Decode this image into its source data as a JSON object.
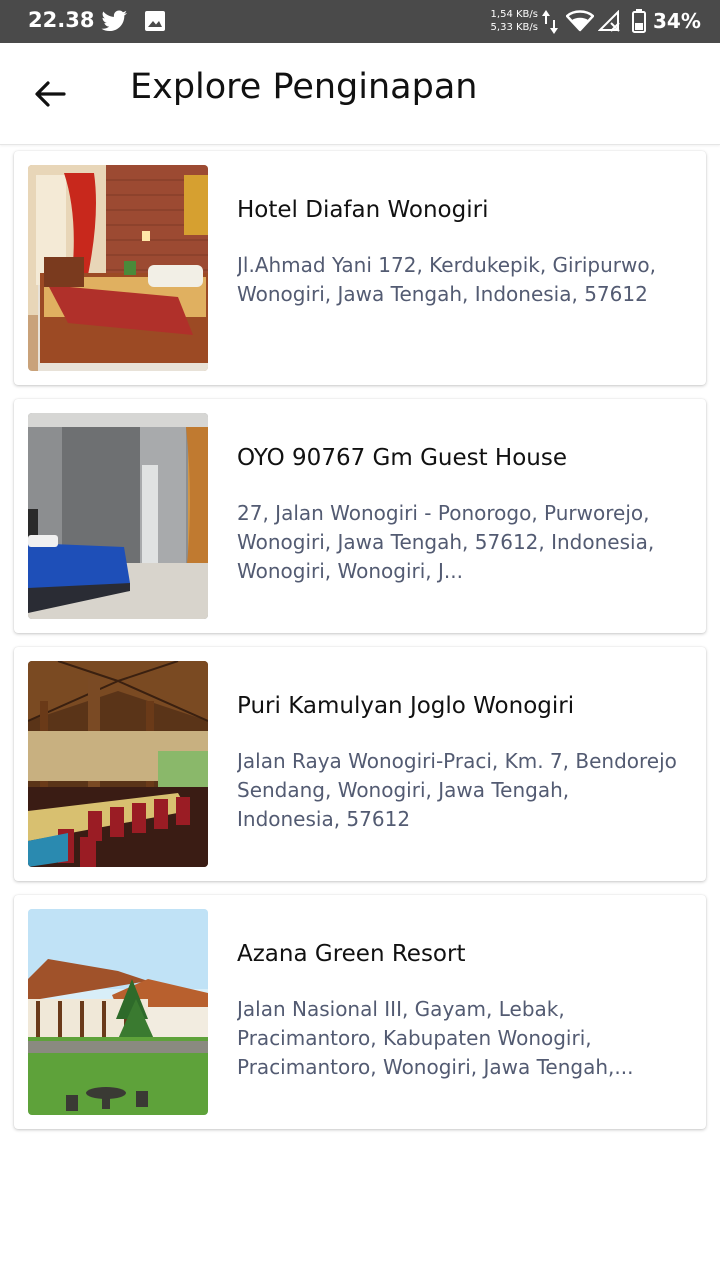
{
  "status_bar": {
    "time": "22.38",
    "speed_up": "1,54 KB/s",
    "speed_down": "5,33 KB/s",
    "battery": "34%",
    "icons": [
      "twitter-icon",
      "image-icon",
      "data-arrows-icon",
      "wifi-icon",
      "signal-icon",
      "battery-icon"
    ]
  },
  "app_bar": {
    "title": "Explore Penginapan",
    "back_icon": "arrow-left-icon"
  },
  "lodgings": [
    {
      "name": "Hotel Diafan Wonogiri",
      "address": "Jl.Ahmad Yani 172, Kerdukepik, Giripurwo, Wonogiri, Jawa Tengah, Indonesia, 57612"
    },
    {
      "name": "OYO 90767 Gm Guest House",
      "address": "27, Jalan Wonogiri - Ponorogo, Purworejo, Wonogiri, Jawa Tengah, 57612, Indonesia, Wonogiri, Wonogiri, J..."
    },
    {
      "name": "Puri Kamulyan Joglo Wonogiri",
      "address": "Jalan Raya Wonogiri-Praci, Km. 7, Bendorejo Sendang, Wonogiri, Jawa Tengah, Indonesia, 57612"
    },
    {
      "name": "Azana Green Resort",
      "address": "Jalan Nasional III, Gayam, Lebak, Pracimantoro, Kabupaten Wonogiri, Pracimantoro, Wonogiri, Jawa Tengah,..."
    }
  ],
  "colors": {
    "status_bar": "#4a4a4a",
    "title_text": "#111111",
    "address_text": "#535b72"
  }
}
